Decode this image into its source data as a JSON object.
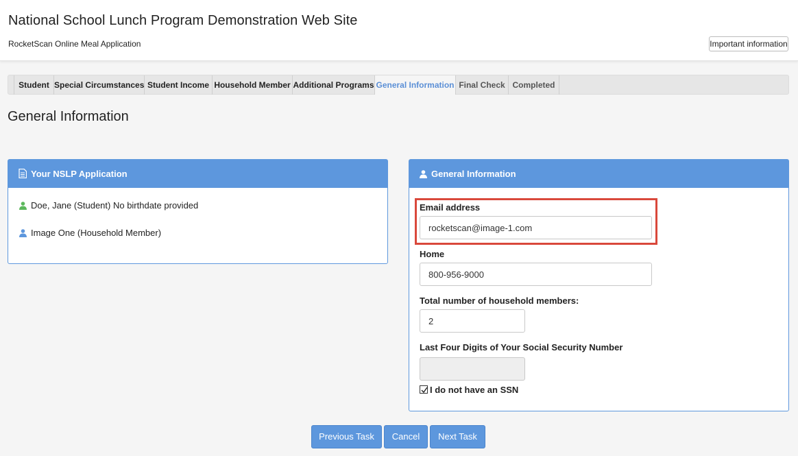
{
  "header": {
    "title": "National School Lunch Program Demonstration Web Site",
    "subtitle": "RocketScan Online Meal Application",
    "important_label": "Important information"
  },
  "tabs": [
    {
      "label": "Student"
    },
    {
      "label": "Special Circumstances"
    },
    {
      "label": "Student Income"
    },
    {
      "label": "Household Member"
    },
    {
      "label": "Additional Programs"
    },
    {
      "label": "General Information"
    },
    {
      "label": "Final Check"
    },
    {
      "label": "Completed"
    }
  ],
  "active_tab": "General Information",
  "page_heading": "General Information",
  "application_panel": {
    "title": "Your NSLP Application",
    "items": [
      {
        "text": "Doe, Jane (Student) No birthdate provided",
        "icon": "user-icon",
        "color": "#5cb85c"
      },
      {
        "text": "Image One (Household Member)",
        "icon": "user-icon",
        "color": "#5d97dd"
      }
    ]
  },
  "general_panel": {
    "title": "General Information",
    "email": {
      "label": "Email address",
      "value": "rocketscan@image-1.com"
    },
    "home": {
      "label": "Home",
      "value": "800-956-9000"
    },
    "household_total": {
      "label": "Total number of household members:",
      "value": "2"
    },
    "ssn": {
      "label": "Last Four Digits of Your Social Security Number",
      "value": ""
    },
    "no_ssn": {
      "label": "I do not have an SSN",
      "checked": true
    }
  },
  "buttons": {
    "previous": "Previous Task",
    "cancel": "Cancel",
    "next": "Next Task"
  },
  "colors": {
    "accent": "#5d97dd",
    "highlight": "#d9483b",
    "student_icon": "#5cb85c"
  }
}
